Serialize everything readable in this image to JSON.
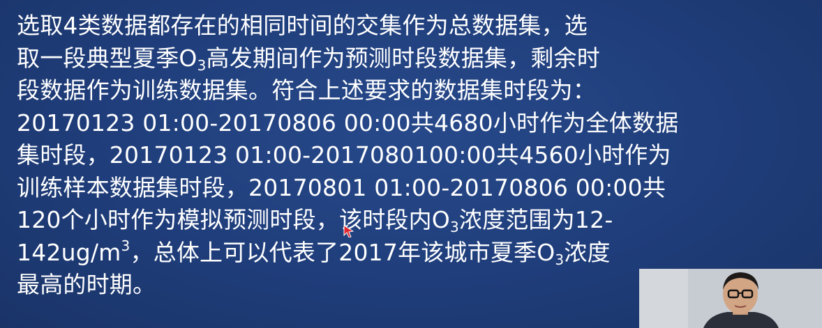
{
  "slide": {
    "lines": [
      {
        "segments": [
          {
            "t": "选取4类数据都存在的相同时间的交集作为总数据集，选"
          }
        ]
      },
      {
        "segments": [
          {
            "t": "取一段典型夏季O"
          },
          {
            "sub": "3"
          },
          {
            "t": "高发期间作为预测时段数据集，剩余时"
          }
        ]
      },
      {
        "segments": [
          {
            "t": "段数据作为训练数据集。符合上述要求的数据集时段为："
          }
        ]
      },
      {
        "segments": [
          {
            "t": "20170123 01:00-20170806 00:00共4680小时作为全体数据"
          }
        ]
      },
      {
        "segments": [
          {
            "t": "集时段，20170123 01:00-2017080100:00共4560小时作为"
          }
        ]
      },
      {
        "segments": [
          {
            "t": "训练样本数据集时段，20170801 01:00-20170806 00:00共"
          }
        ]
      },
      {
        "segments": [
          {
            "t": "120个小时作为模拟预测时段，该时段内O"
          },
          {
            "sub": "3"
          },
          {
            "t": "浓度范围为12-"
          }
        ]
      },
      {
        "segments": [
          {
            "t": "142ug/m"
          },
          {
            "sup": "3"
          },
          {
            "t": "，总体上可以代表了2017年该城市夏季O"
          },
          {
            "sub": "3"
          },
          {
            "t": "浓度"
          }
        ]
      },
      {
        "segments": [
          {
            "t": "最高的时期。"
          }
        ]
      }
    ]
  },
  "colors": {
    "background": "#1f3d7a",
    "text": "#ffffff",
    "cursor": "#e0282e"
  },
  "webcam": {
    "icon": "presenter-webcam"
  }
}
